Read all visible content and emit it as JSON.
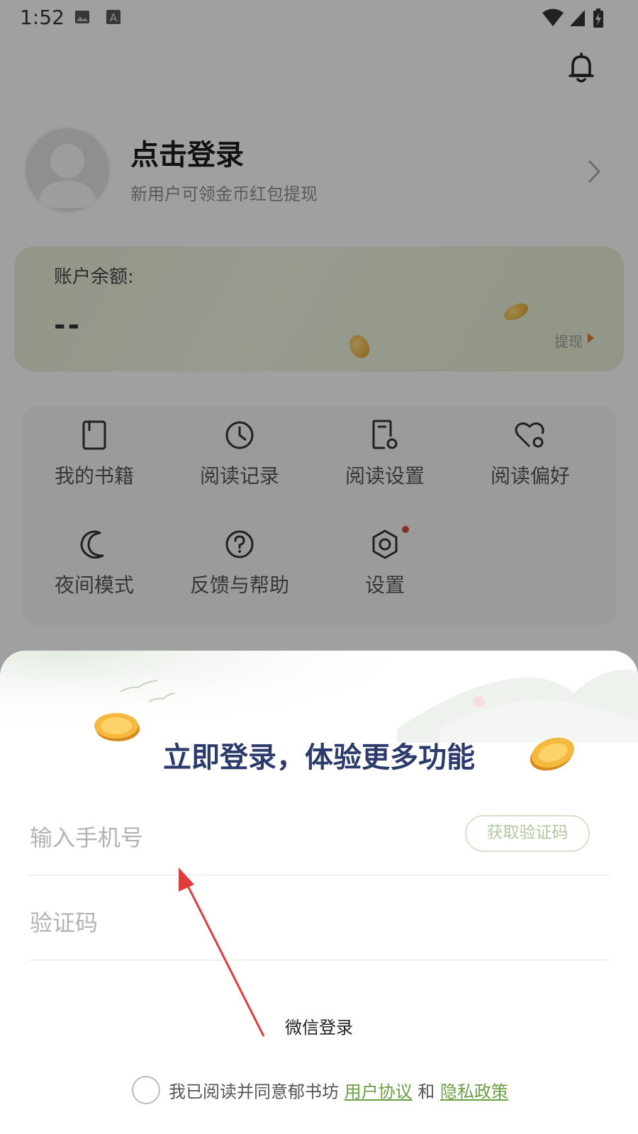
{
  "status_bar": {
    "time": "1:52",
    "icons": [
      "image-icon",
      "text-a-icon",
      "wifi-icon",
      "signal-icon",
      "battery-icon"
    ]
  },
  "profile": {
    "title": "点击登录",
    "subtitle": "新用户可领金币红包提现"
  },
  "balance": {
    "label": "账户余额:",
    "value": "--",
    "withdraw": "提现"
  },
  "menu": [
    {
      "label": "我的书籍",
      "icon": "book-icon"
    },
    {
      "label": "阅读记录",
      "icon": "clock-icon"
    },
    {
      "label": "阅读设置",
      "icon": "reader-settings-icon"
    },
    {
      "label": "阅读偏好",
      "icon": "heart-gear-icon"
    },
    {
      "label": "夜间模式",
      "icon": "moon-icon"
    },
    {
      "label": "反馈与帮助",
      "icon": "help-icon"
    },
    {
      "label": "设置",
      "icon": "hex-settings-icon"
    }
  ],
  "sheet": {
    "title": "立即登录，体验更多功能",
    "phone_placeholder": "输入手机号",
    "get_code": "获取验证码",
    "code_placeholder": "验证码",
    "wechat_login": "微信登录",
    "agree_prefix": "我已阅读并同意郁书坊",
    "user_agreement": "用户协议",
    "and": "和",
    "privacy_policy": "隐私政策"
  },
  "colors": {
    "title_blue": "#2c3b6b",
    "link_green": "#6aa043",
    "annotation_red": "#e03c3c"
  }
}
